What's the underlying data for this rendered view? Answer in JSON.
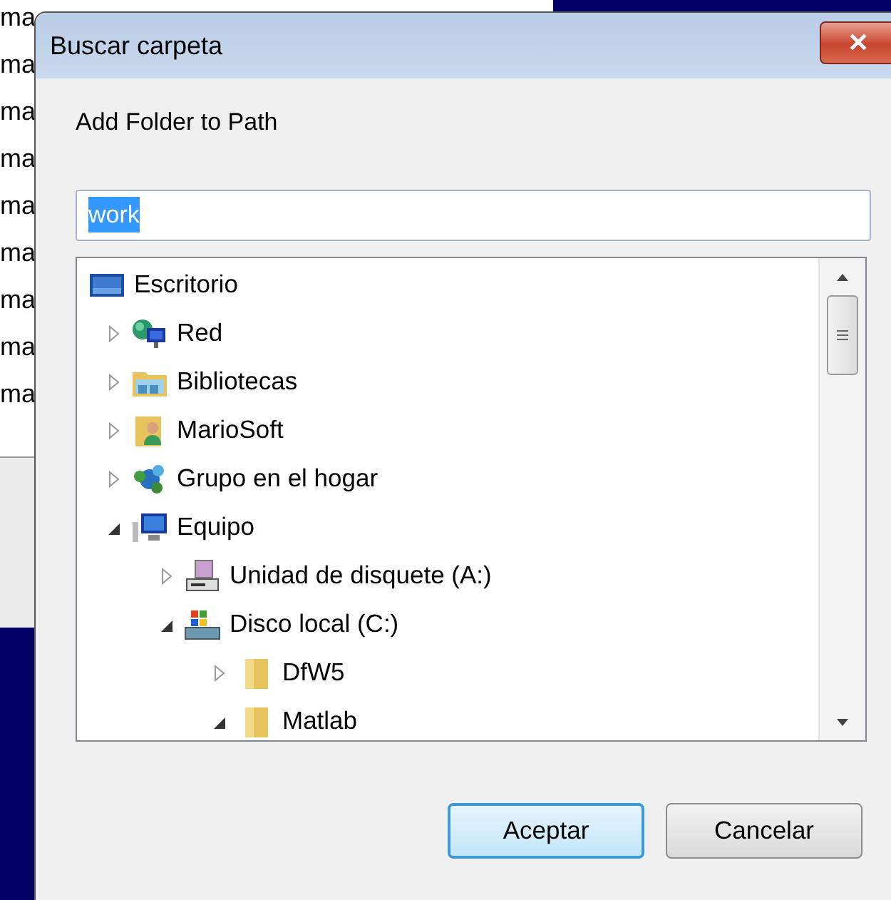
{
  "background": {
    "lines": [
      "ma",
      "ma",
      "ma",
      "ma",
      "ma",
      "ma",
      "ma",
      "ma",
      "ma"
    ]
  },
  "dialog": {
    "title": "Buscar carpeta",
    "close_label": "✕",
    "description": "Add Folder to Path",
    "folder_field": {
      "value": "work",
      "selected": true
    },
    "tree": [
      {
        "label": "Escritorio",
        "kind": "desktop",
        "children": [
          {
            "label": "Red",
            "kind": "network",
            "expanded": false
          },
          {
            "label": "Bibliotecas",
            "kind": "library",
            "expanded": false
          },
          {
            "label": "MarioSoft",
            "kind": "user",
            "expanded": false
          },
          {
            "label": "Grupo en el hogar",
            "kind": "homegroup",
            "expanded": false
          },
          {
            "label": "Equipo",
            "kind": "computer",
            "expanded": true,
            "children": [
              {
                "label": "Unidad de disquete (A:)",
                "kind": "floppy",
                "expanded": false
              },
              {
                "label": "Disco local (C:)",
                "kind": "disk",
                "expanded": true,
                "children": [
                  {
                    "label": "DfW5",
                    "kind": "folder",
                    "expanded": false
                  },
                  {
                    "label": "Matlab",
                    "kind": "folder",
                    "expanded": true
                  }
                ]
              }
            ]
          }
        ]
      }
    ],
    "buttons": [
      {
        "label": "Aceptar",
        "default": true
      },
      {
        "label": "Cancelar",
        "default": false
      }
    ]
  }
}
